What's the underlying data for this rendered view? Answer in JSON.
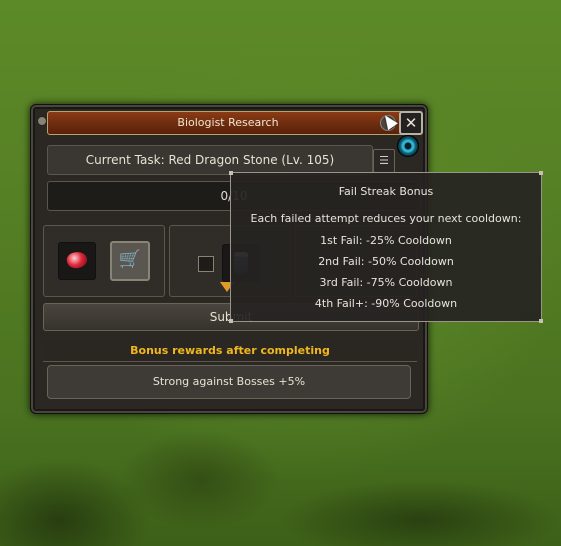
{
  "window": {
    "title": "Biologist Research",
    "help_label": "?",
    "close_label": "✕",
    "current_task": "Current Task: Red Dragon Stone (Lv. 105)",
    "task_button_label": "☰",
    "progress_text": "0/10",
    "progress_fraction": 0,
    "submit_label": "Submit",
    "bonus_header": "Bonus rewards after completing",
    "bonus_item": "Strong against Bosses +5%",
    "slots": [
      {
        "icon": "red-dragon-stone-icon"
      },
      {
        "icon": "shopping-cart-icon"
      },
      {
        "icon": "checkbox"
      },
      {
        "icon": "potion-icon"
      }
    ]
  },
  "tooltip": {
    "title": "Fail Streak Bonus",
    "description": "Each failed attempt reduces your next cooldown:",
    "lines": [
      "1st Fail: -25% Cooldown",
      "2nd Fail: -50% Cooldown",
      "3rd Fail: -75% Cooldown",
      "4th Fail+: -90% Cooldown"
    ]
  },
  "colors": {
    "title_bar": "#6b2b0e",
    "bonus_header": "#f0b81e"
  }
}
